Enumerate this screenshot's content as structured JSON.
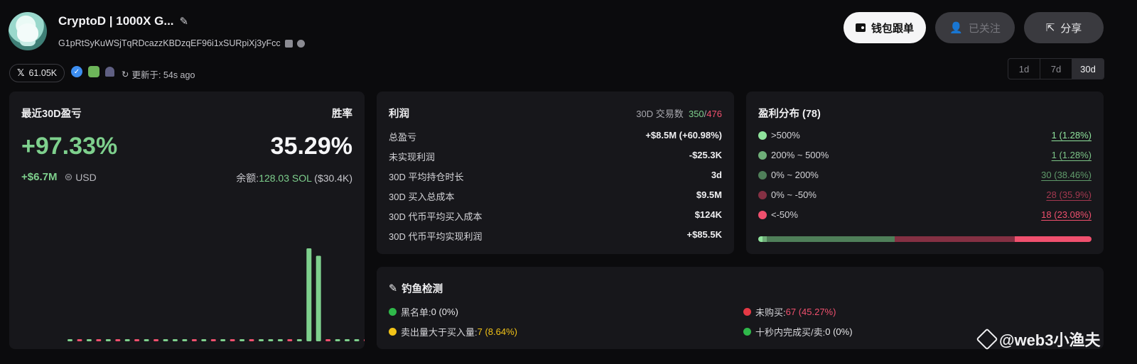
{
  "profile": {
    "name": "CryptoD | 1000X G...",
    "address": "G1pRtSyKuWSjTqRDcazzKBDzqEF96i1xSURpiXj3yFcc",
    "followers": "61.05K",
    "updated": "更新于: 54s ago"
  },
  "actions": {
    "wallet": "钱包跟单",
    "follow": "已关注",
    "share": "分享"
  },
  "periods": [
    "1d",
    "7d",
    "30d"
  ],
  "selected_period": "30d",
  "pnl": {
    "title": "最近30D盈亏",
    "winrate_label": "胜率",
    "percent": "+97.33%",
    "winrate": "35.29%",
    "usd_value": "+$6.7M",
    "currency": "USD",
    "balance_label": "余额:",
    "balance_sol": "128.03 SOL",
    "balance_usd": "($30.4K)"
  },
  "profit": {
    "title": "利润",
    "trades_label": "30D 交易数",
    "trades_win": "350",
    "trades_sep": "/",
    "trades_loss": "476",
    "rows": [
      {
        "label": "总盈亏",
        "value": "+$8.5M (+60.98%)"
      },
      {
        "label": "未实现利润",
        "value": "-$25.3K"
      },
      {
        "label": "30D 平均持仓时长",
        "value": "3d"
      },
      {
        "label": "30D 买入总成本",
        "value": "$9.5M"
      },
      {
        "label": "30D 代币平均买入成本",
        "value": "$124K"
      },
      {
        "label": "30D 代币平均实现利润",
        "value": "+$85.5K"
      }
    ]
  },
  "distribution": {
    "title": "盈利分布 (78)",
    "rows": [
      {
        "label": ">500%",
        "value": "1 (1.28%)",
        "color": "#8fe39c"
      },
      {
        "label": "200% ~ 500%",
        "value": "1 (1.28%)",
        "color": "#6fae79"
      },
      {
        "label": "0% ~ 200%",
        "value": "30 (38.46%)",
        "color": "#4f7f59"
      },
      {
        "label": "0% ~ -50%",
        "value": "28 (35.9%)",
        "color": "#843043"
      },
      {
        "label": "<-50%",
        "value": "18 (23.08%)",
        "color": "#f0506e"
      }
    ],
    "shares": [
      1.28,
      1.28,
      38.46,
      35.9,
      23.08
    ]
  },
  "phishing": {
    "title": "钓鱼检测",
    "items": [
      {
        "label": "黑名单: ",
        "value": "0 (0%)",
        "dot": "#2fb84a",
        "value_color": "#e8e8ea"
      },
      {
        "label": "未购买: ",
        "value": "67 (45.27%)",
        "dot": "#e53945",
        "value_color": "#f0506e"
      },
      {
        "label": "卖出量大于买入量: ",
        "value": "7 (8.64%)",
        "dot": "#f2c318",
        "value_color": "#f2c318"
      },
      {
        "label": "十秒内完成买/卖: ",
        "value": "0 (0%)",
        "dot": "#2fb84a",
        "value_color": "#e8e8ea"
      }
    ]
  },
  "watermark": "@web3小渔夫",
  "chart_data": {
    "type": "bar",
    "title": "",
    "values": [
      0,
      0,
      0,
      0,
      0,
      0,
      0,
      0,
      0,
      0,
      0,
      0,
      0,
      0,
      0,
      0,
      0,
      0,
      0,
      0,
      0,
      0,
      0,
      0,
      0,
      100,
      92,
      0,
      0,
      0,
      0,
      0,
      0,
      0,
      0,
      0
    ],
    "colors": [
      "g",
      "r",
      "g",
      "r",
      "g",
      "r",
      "g",
      "r",
      "g",
      "r",
      "g",
      "g",
      "g",
      "r",
      "g",
      "r",
      "g",
      "r",
      "g",
      "r",
      "g",
      "g",
      "g",
      "r",
      "g",
      "g",
      "g",
      "r",
      "g",
      "g",
      "g",
      "r",
      "r",
      "r",
      "r",
      "r"
    ]
  }
}
